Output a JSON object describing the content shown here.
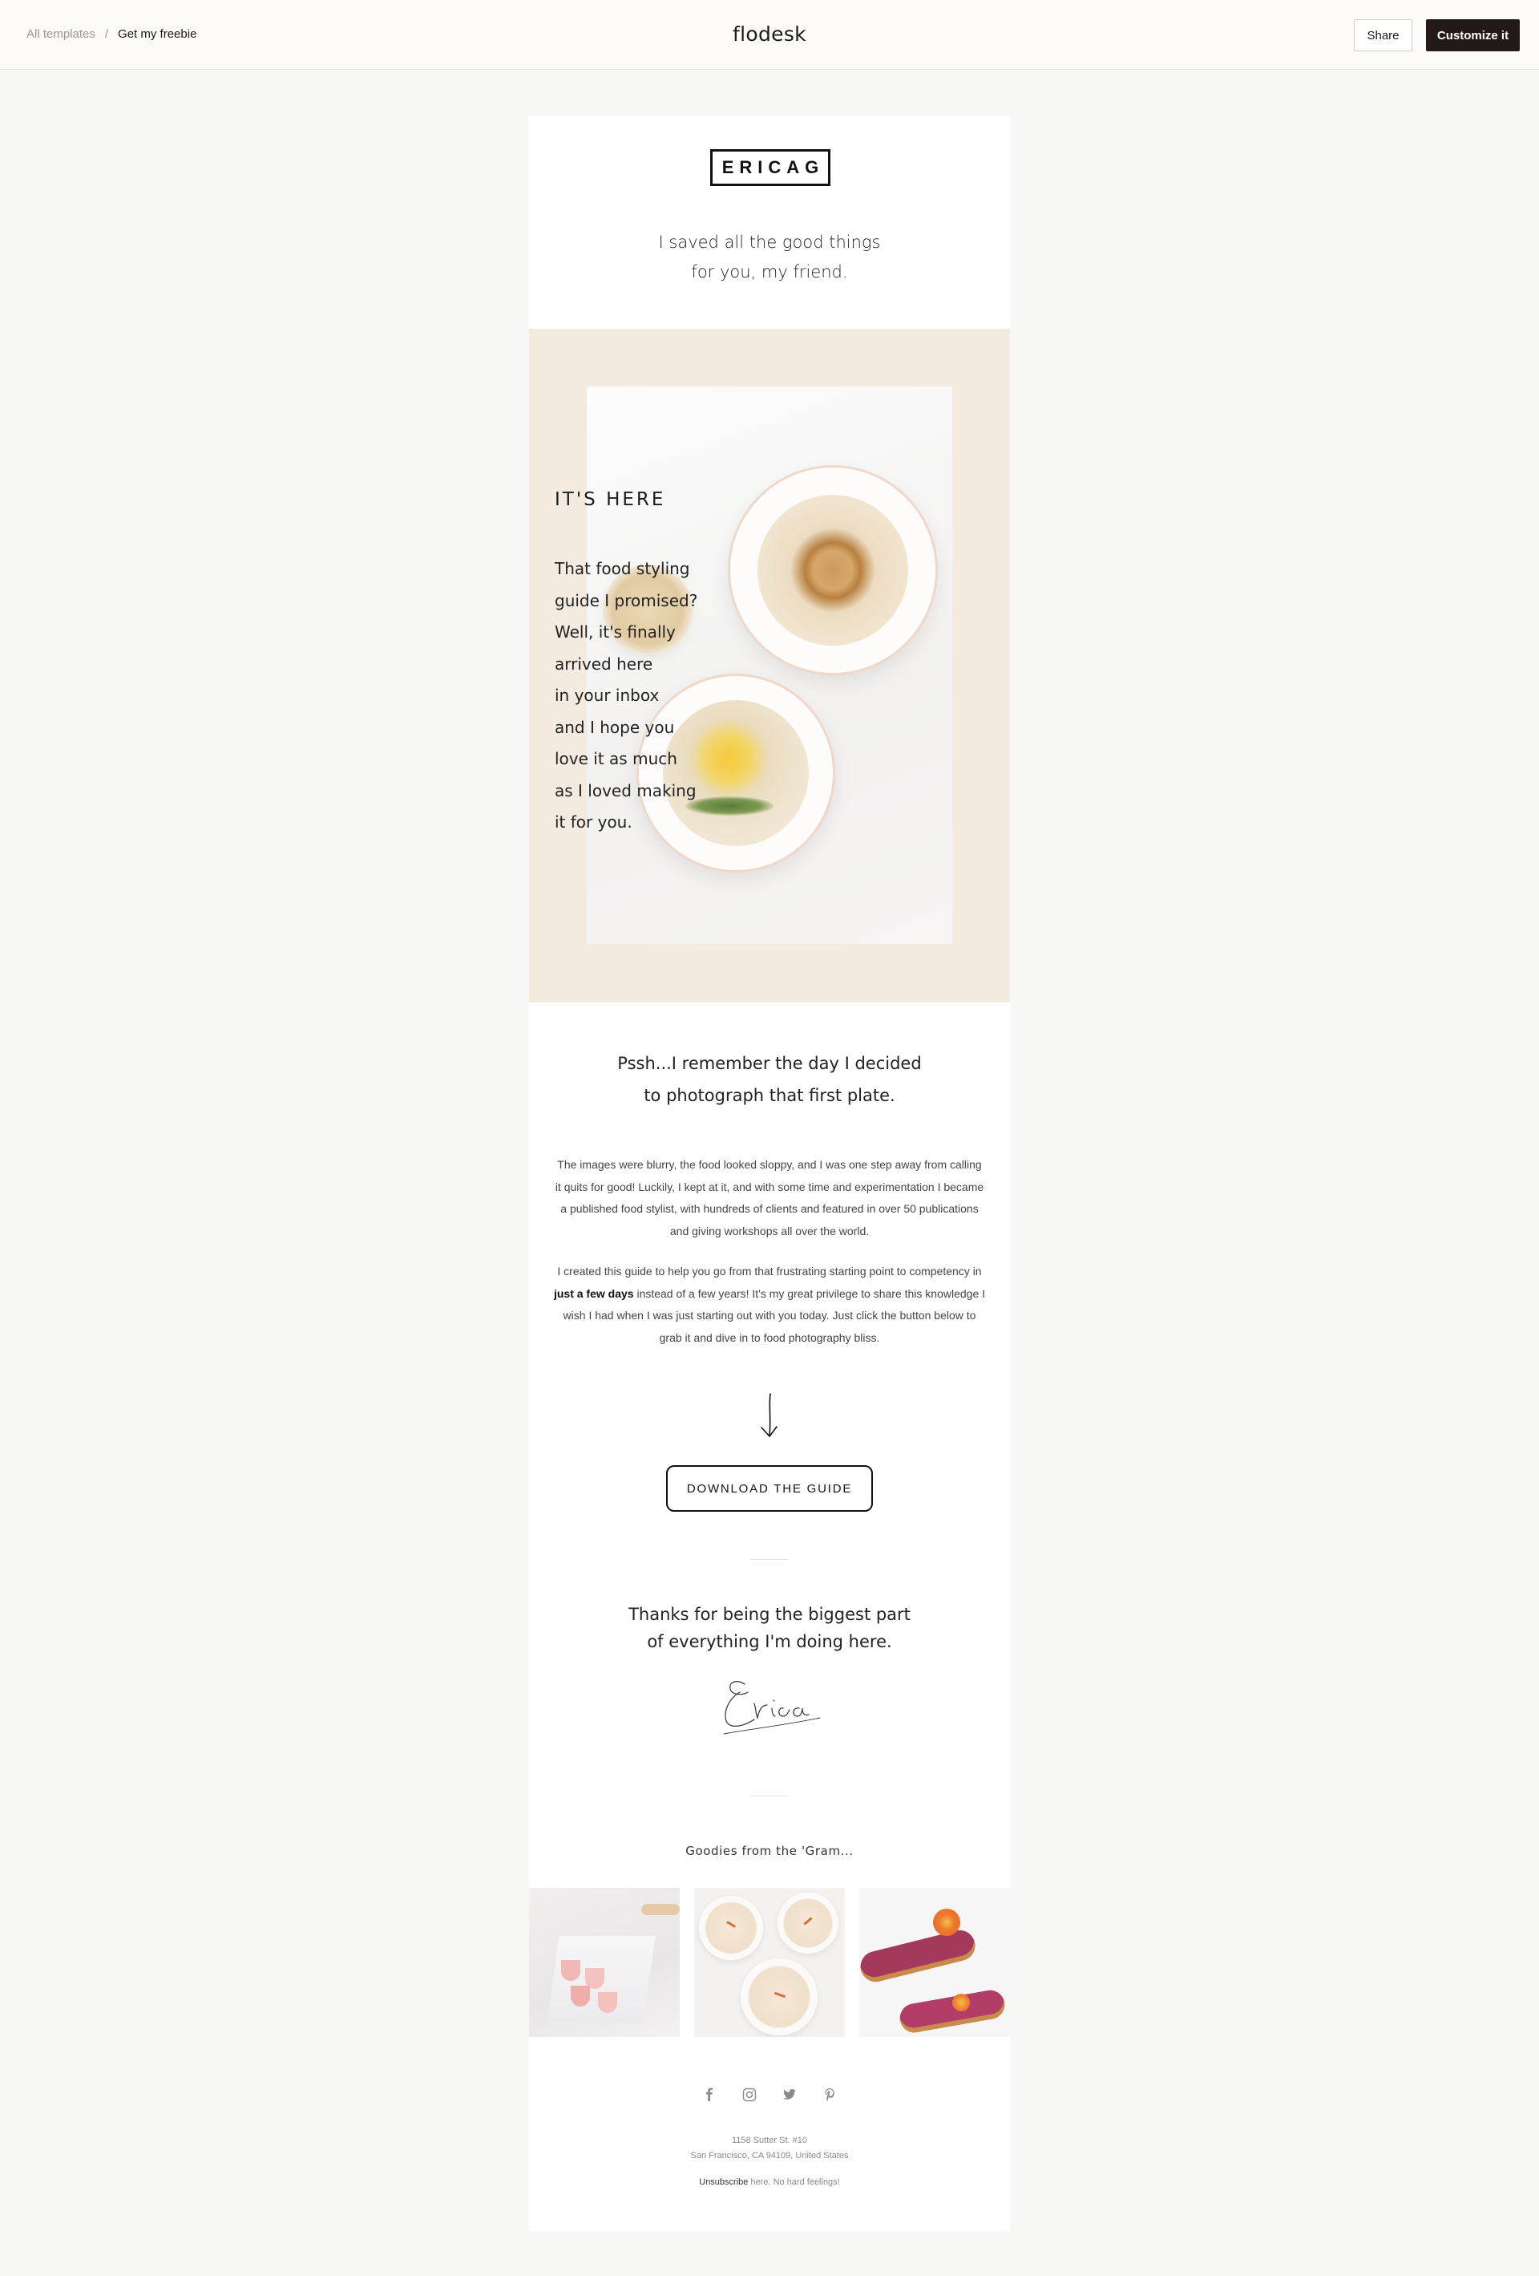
{
  "topbar": {
    "breadcrumb_root": "All templates",
    "breadcrumb_sep": "/",
    "breadcrumb_current": "Get my freebie",
    "brand": "flodesk",
    "share_label": "Share",
    "customize_label": "Customize it"
  },
  "email": {
    "logo": "ERICAG",
    "intro_line1": "I saved all the good things",
    "intro_line2": "for you, my friend.",
    "hero": {
      "heading": "IT'S HERE",
      "lines": [
        "That food styling",
        "guide I promised?",
        "Well, it's finally",
        "arrived here",
        "in your inbox",
        "and I hope you",
        "love it as much",
        "as I loved making",
        "it for you."
      ]
    },
    "lead_line1": "Pssh...I remember the day I decided",
    "lead_line2": "to photograph that first plate.",
    "para1": "The images were blurry, the food looked sloppy, and I was one step away from calling it quits for good! Luckily, I kept at it, and with some time and experimentation I became a published food stylist, with hundreds of clients and featured in over 50 publications and giving workshops all over the world.",
    "para2_before": "I created this guide to help you go from that frustrating starting point to competency in ",
    "para2_bold": "just a few days",
    "para2_after": " instead of a few years! It's my great privilege to share this knowledge I wish I had when I was just starting out with you today. Just click the button below to grab it and dive in to food photography bliss.",
    "cta_label": "DOWNLOAD THE GUIDE",
    "thanks_line1": "Thanks for being the biggest part",
    "thanks_line2": "of everything I'm doing here.",
    "signature": "Erica",
    "gram_label": "Goodies from the 'Gram...",
    "social_icons": [
      "facebook-icon",
      "instagram-icon",
      "twitter-icon",
      "pinterest-icon"
    ],
    "address_line1": "1158 Sutter St. #10",
    "address_line2": "San Francisco, CA 94109, United States",
    "unsubscribe_link": "Unsubscribe",
    "unsubscribe_rest": " here. No hard feelings!"
  },
  "colors": {
    "hero_bg": "#f4ebe0",
    "customize_bg": "#221a18",
    "page_bg": "#f7f7f6"
  }
}
